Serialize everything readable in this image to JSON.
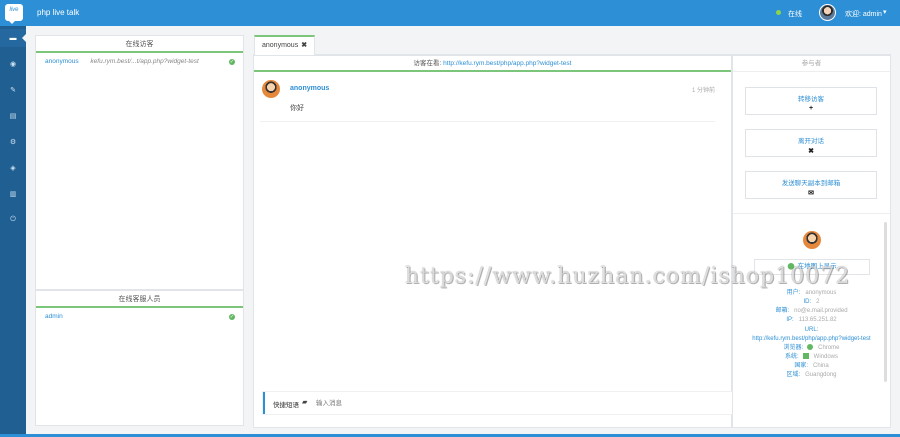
{
  "app": {
    "title": "php live talk",
    "logo_text": "live"
  },
  "header": {
    "status": "在线",
    "user_label": "欢迎: admin"
  },
  "nav": {
    "icons": [
      "chat-icon",
      "location-icon",
      "wrench-icon",
      "list-icon",
      "settings-icon",
      "layers-icon",
      "chart-icon",
      "power-icon"
    ]
  },
  "visitors": {
    "title": "在线访客",
    "items": [
      {
        "name": "anonymous",
        "url": "kefu.rym.best/...t/app.php?widget-test"
      }
    ]
  },
  "agents": {
    "title": "在线客服人员",
    "items": [
      {
        "name": "admin"
      }
    ]
  },
  "tab": {
    "label": "anonymous",
    "close": "✖"
  },
  "chat": {
    "header_prefix": "访客在看:",
    "header_url": "http://kefu.rym.best/php/app.php?widget-test",
    "message": {
      "name": "anonymous",
      "time": "1 分钟前",
      "text": "你好"
    },
    "input_label": "快捷短语",
    "input_placeholder": "输入消息"
  },
  "side": {
    "title": "参与者",
    "buttons": [
      {
        "label": "转移访客",
        "icon": "+"
      },
      {
        "label": "离开对话",
        "icon": "✖"
      },
      {
        "label": "发送聊天副本到邮箱",
        "icon": "✉"
      }
    ],
    "location": "在地图上显示",
    "info": {
      "name_k": "用户:",
      "name_v": "anonymous",
      "id_k": "ID:",
      "id_v": "2",
      "email_k": "邮箱:",
      "email_v": "no@e.mail.provided",
      "ip_k": "IP:",
      "ip_v": "113.65.251.82",
      "url_k": "URL:",
      "url_v": "http://kefu.rym.best/php/app.php?widget-test",
      "browser_k": "浏览器:",
      "browser_v": "Chrome",
      "os_k": "系统:",
      "os_v": "Windows",
      "country_k": "国家:",
      "country_v": "China",
      "region_k": "区域:",
      "region_v": "Guangdong"
    }
  },
  "watermark": "https://www.huzhan.com/ishop10072"
}
